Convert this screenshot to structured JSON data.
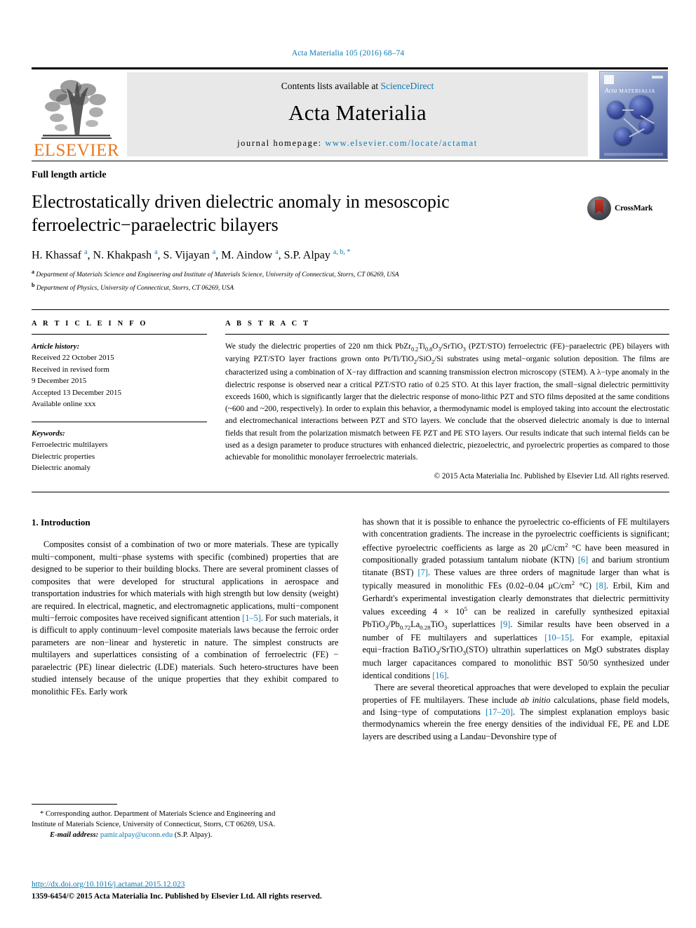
{
  "running_head": "Acta Materialia 105 (2016) 68–74",
  "masthead": {
    "publisher_name": "ELSEVIER",
    "contents_prefix": "Contents lists available at ",
    "sciencedirect": "ScienceDirect",
    "journal_name": "Acta Materialia",
    "homepage_label": "journal homepage: ",
    "homepage_url": "www.elsevier.com/locate/actamat",
    "cover_title_italic": "Acta",
    "cover_title_small": "MATERIALIA"
  },
  "article": {
    "type": "Full length article",
    "title": "Electrostatically driven dielectric anomaly in mesoscopic ferroelectric−paraelectric bilayers",
    "crossmark_label": "CrossMark",
    "authors_html": "H. Khassaf <sup>a</sup>, N. Khakpash <sup>a</sup>, S. Vijayan <sup>a</sup>, M. Aindow <sup>a</sup>, S.P. Alpay <sup>a, b, *</sup>",
    "affiliation_a": "Department of Materials Science and Engineering and Institute of Materials Science, University of Connecticut, Storrs, CT 06269, USA",
    "affiliation_b": "Department of Physics, University of Connecticut, Storrs, CT 06269, USA"
  },
  "article_info": {
    "heading": "A R T I C L E  I N F O",
    "history_label": "Article history:",
    "history": [
      "Received 22 October 2015",
      "Received in revised form",
      "9 December 2015",
      "Accepted 13 December 2015",
      "Available online xxx"
    ],
    "keywords_label": "Keywords:",
    "keywords": [
      "Ferroelectric multilayers",
      "Dielectric properties",
      "Dielectric anomaly"
    ]
  },
  "abstract": {
    "heading": "A B S T R A C T",
    "text_html": "We study the dielectric properties of 220 nm thick PbZr<sub>0.2</sub>Ti<sub>0.8</sub>O<sub>3</sub>/SrTiO<sub>3</sub> (PZT/STO) ferroelectric (FE)−paraelectric (PE) bilayers with varying PZT/STO layer fractions grown onto Pt/Ti/TiO<sub>2</sub>/SiO<sub>2</sub>/Si substrates using metal−organic solution deposition. The films are characterized using a combination of X−ray diffraction and scanning transmission electron microscopy (STEM). A λ−type anomaly in the dielectric response is observed near a critical PZT/STO ratio of 0.25 STO. At this layer fraction, the small−signal dielectric permittivity exceeds 1600, which is significantly larger that the dielectric response of mono-lithic PZT and STO films deposited at the same conditions (~600 and ~200, respectively). In order to explain this behavior, a thermodynamic model is employed taking into account the electrostatic and electromechanical interactions between PZT and STO layers. We conclude that the observed dielectric anomaly is due to internal fields that result from the polarization mismatch between FE PZT and PE STO layers. Our results indicate that such internal fields can be used as a design parameter to produce structures with enhanced dielectric, piezoelectric, and pyroelectric properties as compared to those achievable for monolithic monolayer ferroelectric materials.",
    "copyright": "© 2015 Acta Materialia Inc. Published by Elsevier Ltd. All rights reserved."
  },
  "body": {
    "section_number_title": "1.  Introduction",
    "left_para_1_html": "Composites consist of a combination of two or more materials. These are typically multi−component, multi−phase systems with specific (combined) properties that are designed to be superior to their building blocks. There are several prominent classes of composites that were developed for structural applications in aerospace and transportation industries for which materials with high strength but low density (weight) are required. In electrical, magnetic, and electromagnetic applications, multi−component multi−ferroic composites have received significant attention <span class=\"ref\">[1‒5]</span>. For such materials, it is difficult to apply continuum−level composite materials laws because the ferroic order parameters are non−linear and hysteretic in nature. The simplest constructs are multilayers and superlattices consisting of a combination of ferroelectric (FE) − paraelectric (PE) linear dielectric (LDE) materials. Such hetero-structures have been studied intensely because of the unique properties that they exhibit compared to monolithic FEs. Early work",
    "right_para_1_html": "has shown that it is possible to enhance the pyroelectric co-efficients of FE multilayers with concentration gradients. The increase in the pyroelectric coefficients is significant; effective pyroelectric coefficients as large as 20 μC/cm<sup class=\"num\">2</sup> °C have been measured in compositionally graded potassium tantalum niobate (KTN) <span class=\"ref\">[6]</span> and barium strontium titanate (BST) <span class=\"ref\">[7]</span>. These values are three orders of magnitude larger than what is typically measured in monolithic FEs (0.02‒0.04 μC/cm<sup class=\"num\">2</sup> °C) <span class=\"ref\">[8]</span>. Erbil, Kim and Gerhardt's experimental investigation clearly demonstrates that dielectric permittivity values exceeding 4 × 10<sup class=\"num\">5</sup> can be realized in carefully synthesized epitaxial PbTiO<sub>3</sub>/Pb<sub>0.72</sub>La<sub>0.28</sub>TiO<sub>3</sub> superlattices <span class=\"ref\">[9]</span>. Similar results have been observed in a number of FE multilayers and superlattices <span class=\"ref\">[10‒15]</span>. For example, epitaxial equi−fraction BaTiO<sub>3</sub>/SrTiO<sub>3</sub>(STO) ultrathin superlattices on MgO substrates display much larger capacitances compared to monolithic BST 50/50 synthesized under identical conditions <span class=\"ref\">[16]</span>.",
    "right_para_2_html": "There are several theoretical approaches that were developed to explain the peculiar properties of FE multilayers. These include <span class=\"ital\">ab initio</span> calculations, phase field models, and Ising−type of computations <span class=\"ref\">[17‒20]</span>. The simplest explanation employs basic thermodynamics wherein the free energy densities of the individual FE, PE and LDE layers are described using a Landau−Devonshire type of"
  },
  "footnote": {
    "line1": "* Corresponding author. Department of Materials Science and Engineering and",
    "line2": "Institute of Materials Science, University of Connecticut, Storrs, CT 06269, USA.",
    "email_label": "E-mail address:",
    "email": "pamir.alpay@uconn.edu",
    "email_suffix": " (S.P. Alpay)."
  },
  "footer": {
    "doi": "http://dx.doi.org/10.1016/j.actamat.2015.12.023",
    "issn_line": "1359-6454/© 2015 Acta Materialia Inc. Published by Elsevier Ltd. All rights reserved."
  },
  "colors": {
    "link_blue": "#0b7ab5",
    "elsevier_orange": "#E87722",
    "crossmark_red": "#c0392b"
  }
}
